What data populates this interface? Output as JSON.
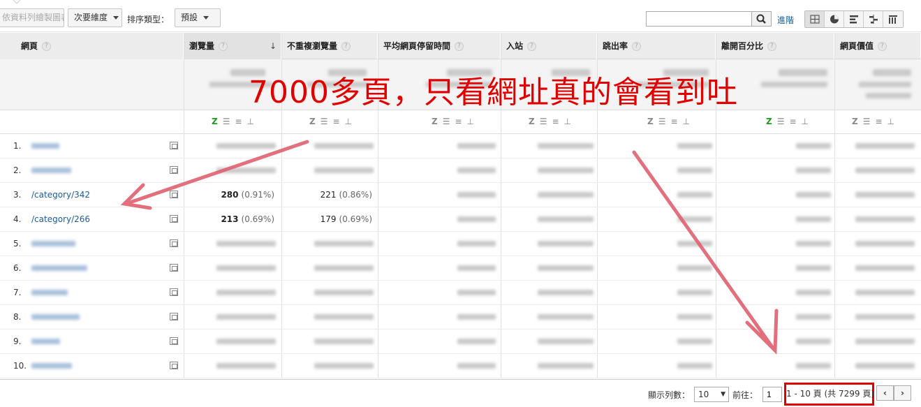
{
  "toolbar": {
    "chart_button": "依資料列繪製圖表",
    "secondary_dimension": "次要維度",
    "sort_type_label": "排序類型：",
    "sort_type_value": "預設",
    "search_placeholder": "",
    "advanced_link": "進階"
  },
  "table": {
    "columns": [
      {
        "label": "網頁"
      },
      {
        "label": "瀏覽量"
      },
      {
        "label": "不重複瀏覽量"
      },
      {
        "label": "平均網頁停留時間"
      },
      {
        "label": "入站"
      },
      {
        "label": "跳出率"
      },
      {
        "label": "離開百分比"
      },
      {
        "label": "網頁價值"
      }
    ],
    "sort_indicator": "↓",
    "help_glyph": "?",
    "rows": [
      {
        "num": "1.",
        "page": "",
        "views": "",
        "views_pct": "",
        "unique": "",
        "unique_pct": ""
      },
      {
        "num": "2.",
        "page": "",
        "views": "",
        "views_pct": "",
        "unique": "",
        "unique_pct": ""
      },
      {
        "num": "3.",
        "page": "/category/342",
        "views": "280",
        "views_pct": "(0.91%)",
        "unique": "221",
        "unique_pct": "(0.86%)"
      },
      {
        "num": "4.",
        "page": "/category/266",
        "views": "213",
        "views_pct": "(0.69%)",
        "unique": "179",
        "unique_pct": "(0.69%)"
      },
      {
        "num": "5.",
        "page": "",
        "views": "",
        "views_pct": "",
        "unique": "",
        "unique_pct": ""
      },
      {
        "num": "6.",
        "page": "",
        "views": "",
        "views_pct": "",
        "unique": "",
        "unique_pct": ""
      },
      {
        "num": "7.",
        "page": "",
        "views": "",
        "views_pct": "",
        "unique": "",
        "unique_pct": ""
      },
      {
        "num": "8.",
        "page": "",
        "views": "",
        "views_pct": "",
        "unique": "",
        "unique_pct": ""
      },
      {
        "num": "9.",
        "page": "",
        "views": "",
        "views_pct": "",
        "unique": "",
        "unique_pct": ""
      },
      {
        "num": "10.",
        "page": "",
        "views": "",
        "views_pct": "",
        "unique": "",
        "unique_pct": ""
      }
    ]
  },
  "footer": {
    "rows_label": "顯示列數：",
    "rows_value": "10",
    "goto_label": "前往：",
    "goto_value": "1",
    "page_info": "1 - 10 頁 (共 7299 頁)",
    "prev": "‹",
    "next": "›"
  },
  "annotation": {
    "text": "7000多頁，只看網址真的會看到吐",
    "color": "#e00000",
    "arrow_color": "#e06070"
  },
  "colors": {
    "link": "#1a5c9e",
    "header_bg": "#ececec",
    "active_z": "#1e9a1e"
  }
}
